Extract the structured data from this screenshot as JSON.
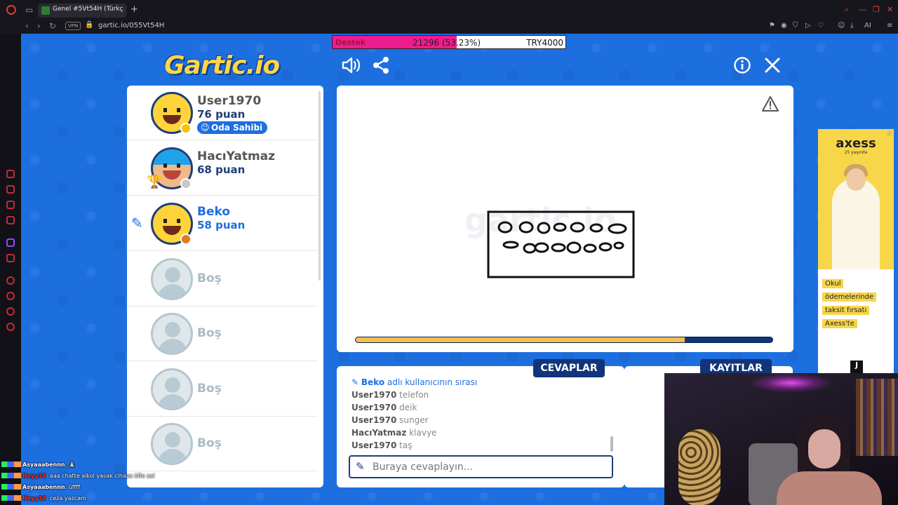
{
  "browser": {
    "tab_title": "Genel #5Vt54H (Türkçe) - G",
    "url": "gartic.io/055Vt54H",
    "vpn_label": "VPN",
    "ai_label": "AI"
  },
  "donation_bar": {
    "label": "Destek",
    "amount_text": "21296 (53.23%)",
    "goal_text": "TRY4000",
    "progress_fraction": 0.5323,
    "fill_color": "#ee1c8e"
  },
  "logo": {
    "main": "Gartic",
    "suffix": ".io"
  },
  "players": [
    {
      "name": "User1970",
      "points": "76 puan",
      "badge": "Oda Sahibi",
      "avatar": "yellow-smiley",
      "status_color": "#f4c400",
      "state": "normal"
    },
    {
      "name": "HacıYatmaz",
      "points": "68 puan",
      "badge": "",
      "avatar": "blue-hair-girl",
      "status_color": "#c8c8c8",
      "state": "normal",
      "trophy": "1"
    },
    {
      "name": "Beko",
      "points": "58 puan",
      "badge": "",
      "avatar": "yellow-smiley",
      "status_color": "#e07a1a",
      "state": "drawing"
    },
    {
      "name": "Boş",
      "points": "",
      "state": "empty"
    },
    {
      "name": "Boş",
      "points": "",
      "state": "empty"
    },
    {
      "name": "Boş",
      "points": "",
      "state": "empty"
    },
    {
      "name": "Boş",
      "points": "",
      "state": "empty"
    }
  ],
  "canvas": {
    "timer_fraction": 0.79,
    "timer_color": "#f1c04a"
  },
  "tabs": {
    "answers": "CEVAPLAR",
    "records": "KAYITLAR"
  },
  "answers_log": {
    "turn_user": "Beko",
    "turn_text": "adlı kullanıcının sırası",
    "lines": [
      {
        "user": "User1970",
        "guess": "telefon"
      },
      {
        "user": "User1970",
        "guess": "deik"
      },
      {
        "user": "User1970",
        "guess": "sunger"
      },
      {
        "user": "HacıYatmaz",
        "guess": "klavye"
      },
      {
        "user": "User1970",
        "guess": "taş"
      }
    ],
    "input_placeholder": "Buraya cevaplayın..."
  },
  "ad": {
    "brand": "axess",
    "brand_sub": "25 yaşında",
    "taglines": [
      "Okul",
      "ödemelerinde",
      "taksit fırsatı",
      "Axess'te"
    ],
    "corner_logo": "J"
  },
  "stream_chat": [
    {
      "user": "Asyaaabennn",
      "message": ": 🙏🏻",
      "user_color": "#ffffff"
    },
    {
      "user": "Neyy34",
      "message": ": aaa chatte alkol yasak cihaza üfle asl",
      "user_color": "#ff2a2a"
    },
    {
      "user": "Asyaaabennn",
      "message": ": üffff",
      "user_color": "#ffffff"
    },
    {
      "user": "Neyy34",
      "message": ": ceza yazcam",
      "user_color": "#ff2a2a"
    }
  ]
}
